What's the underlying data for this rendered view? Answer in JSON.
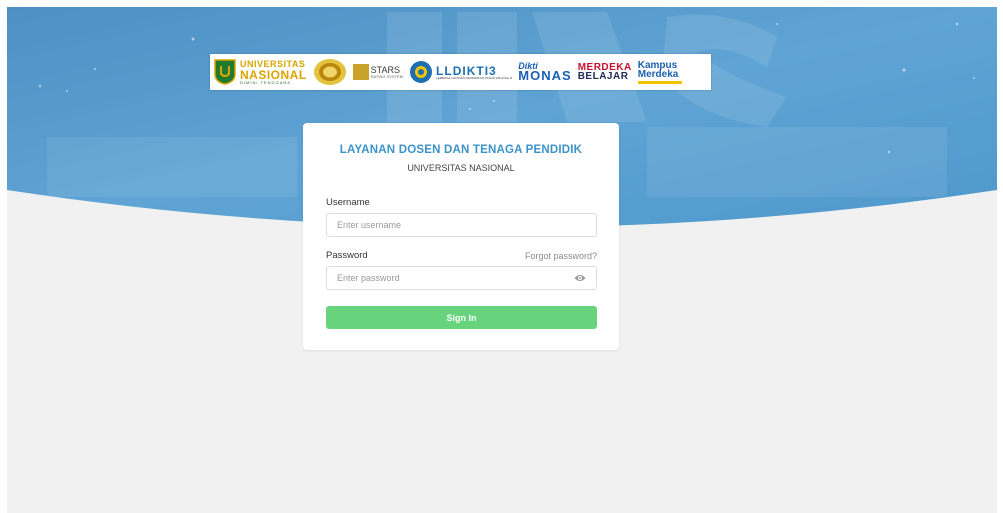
{
  "logos": {
    "unas": {
      "line1": "UNIVERSITAS",
      "line2": "NASIONAL",
      "line3": "DIMINI TENGGARA"
    },
    "stars": {
      "line1": "STARS",
      "line2": "RATING SYSTEM"
    },
    "dikti": {
      "main": "LLDIKTI3",
      "sub": "LEMBAGA LAYANAN PENDIDIKAN TINGGI WILAYAH III"
    },
    "monas": {
      "line1": "Dikti",
      "line2": "MONAS"
    },
    "merdeka": {
      "line1": "MERDEKA",
      "line2": "BELAJAR"
    },
    "kampus": {
      "line1": "Kampus",
      "line2": "Merdeka"
    }
  },
  "card": {
    "title": "LAYANAN DOSEN DAN TENAGA PENDIDIK",
    "subtitle": "UNIVERSITAS NASIONAL"
  },
  "form": {
    "username_label": "Username",
    "username_placeholder": "Enter username",
    "username_value": "",
    "password_label": "Password",
    "forgot_label": "Forgot password?",
    "password_placeholder": "Enter password",
    "password_value": "",
    "sign_in_label": "Sign In"
  },
  "colors": {
    "accent_title": "#3b93c8",
    "button": "#67d47d",
    "hero_blue": "#5a9fd0"
  }
}
